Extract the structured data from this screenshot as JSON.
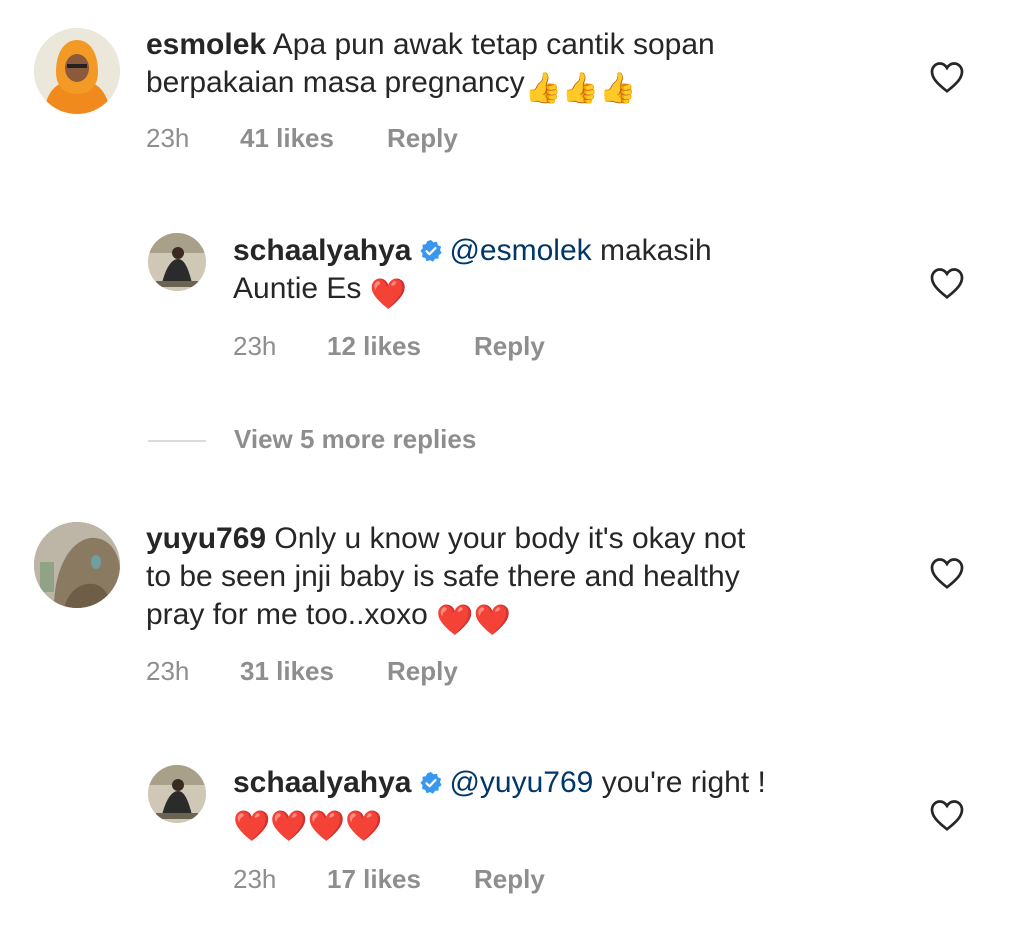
{
  "comments": [
    {
      "username": "esmolek",
      "text_line1": "Apa pun awak tetap cantik sopan",
      "text_line2": "berpakaian masa pregnancy",
      "emojis": "👍👍👍",
      "time": "23h",
      "likes": "41 likes",
      "reply_label": "Reply"
    },
    {
      "username": "schaalyahya",
      "mention": "@esmolek",
      "text_line1": " makasih",
      "text_line2": "Auntie Es ",
      "emojis": "❤️",
      "time": "23h",
      "likes": "12 likes",
      "reply_label": "Reply"
    },
    {
      "username": "yuyu769",
      "text_line1": "Only u know your body it's okay not",
      "text_line2": "to be seen jnji baby is safe there and healthy",
      "text_line3": "pray for me too..xoxo ",
      "emojis": "❤️❤️",
      "time": "23h",
      "likes": "31 likes",
      "reply_label": "Reply"
    },
    {
      "username": "schaalyahya",
      "mention": "@yuyu769",
      "text_line1": " you're right !",
      "emojis": "❤️❤️❤️❤️",
      "time": "23h",
      "likes": "17 likes",
      "reply_label": "Reply"
    }
  ],
  "view_more_replies": "View 5 more replies",
  "colors": {
    "text": "#262626",
    "meta": "#8e8e8e",
    "mention": "#00376b",
    "verified": "#3897f0",
    "heart": "#e0245e"
  }
}
